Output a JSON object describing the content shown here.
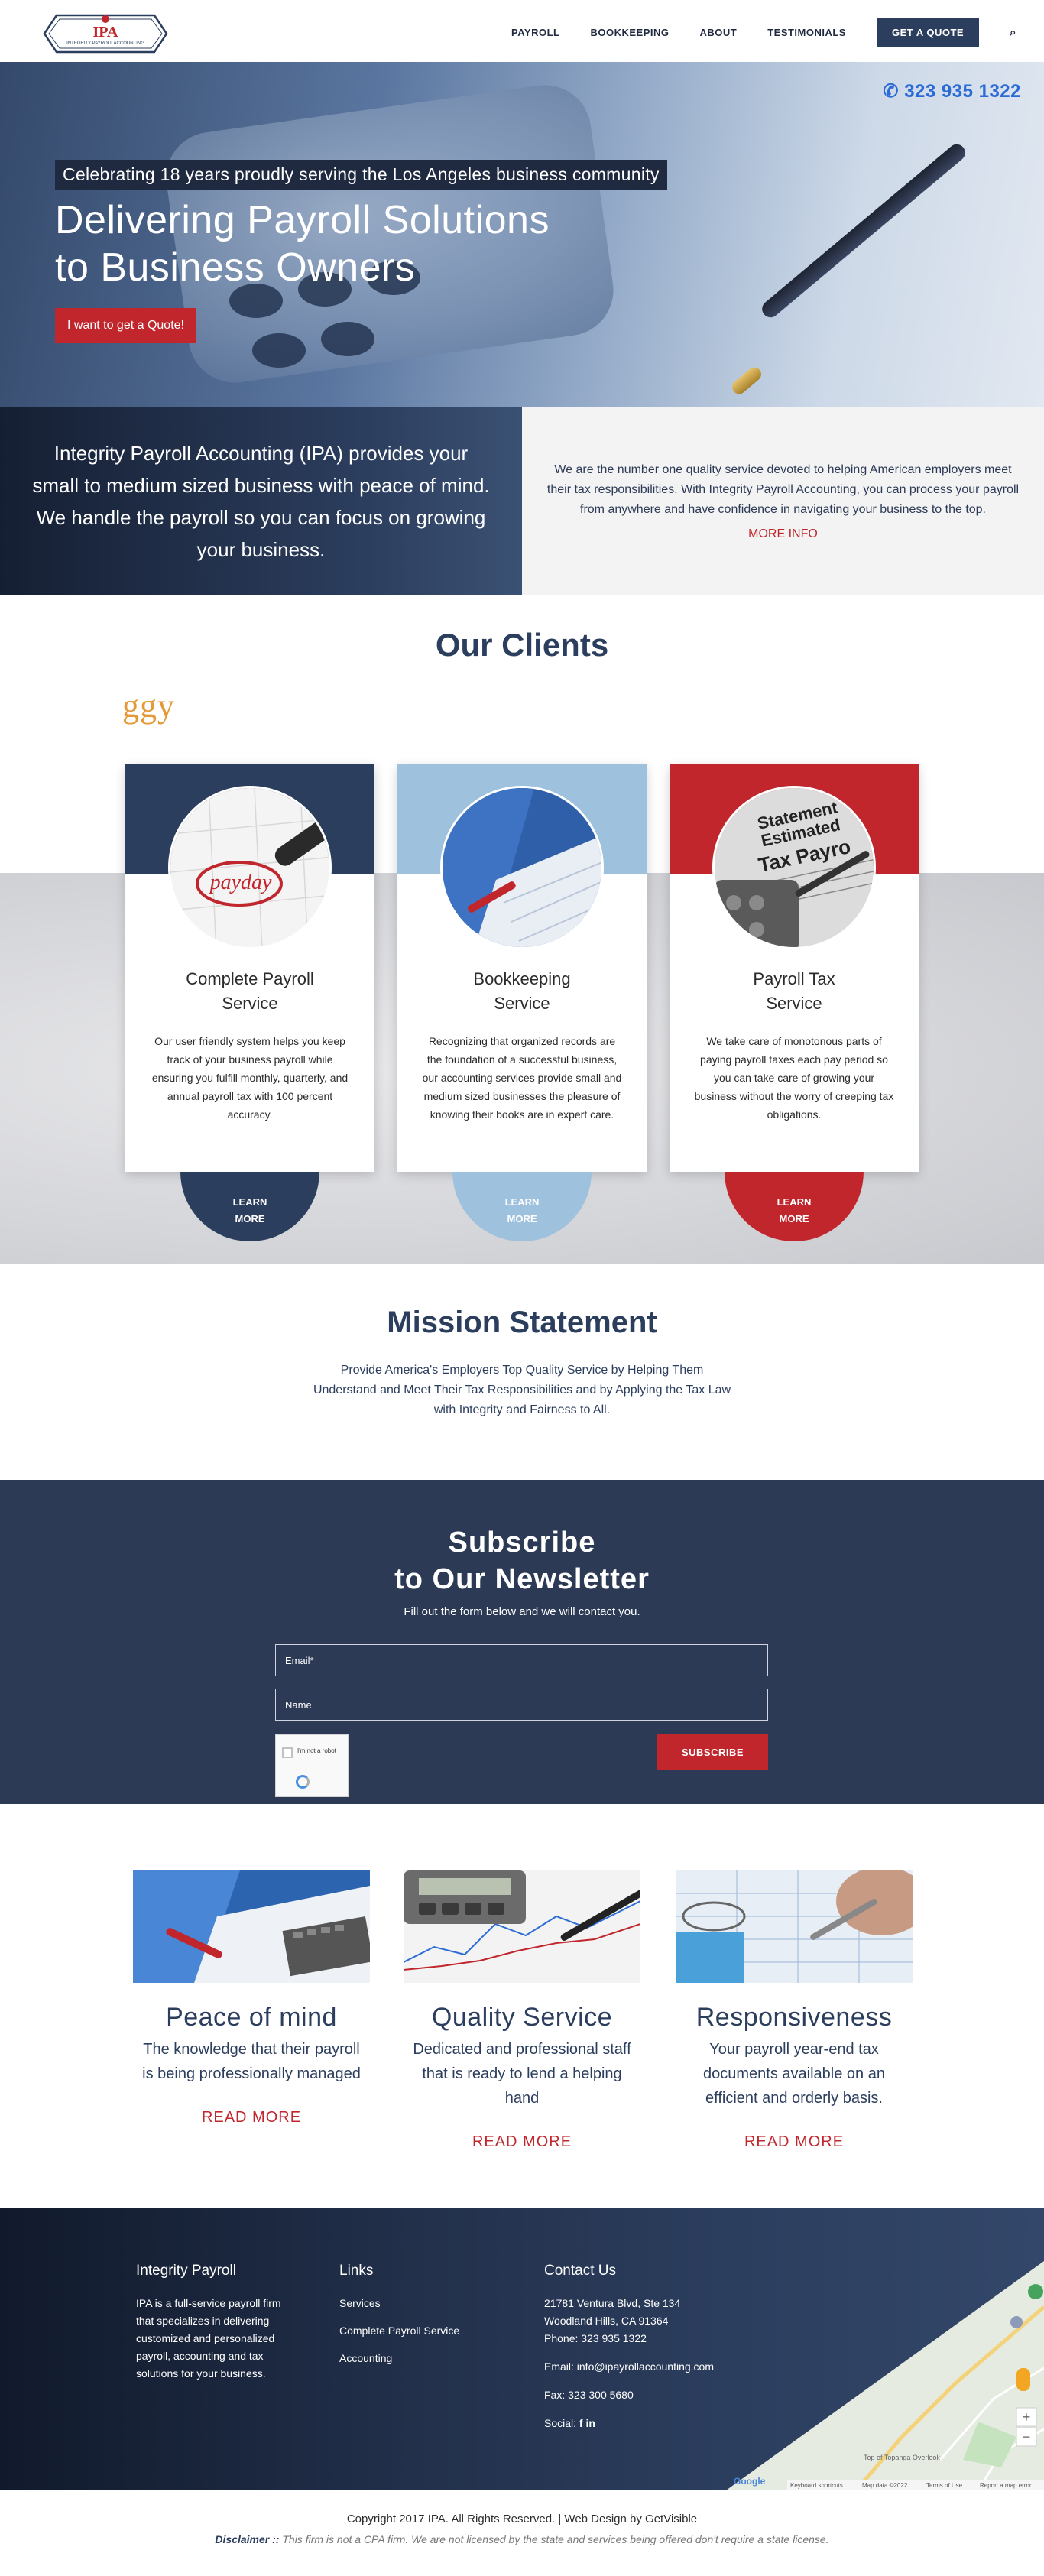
{
  "header": {
    "logo_text": "IPA",
    "logo_subtext": "INTEGRITY PAYROLL ACCOUNTING",
    "nav": [
      "PAYROLL",
      "BOOKKEEPING",
      "ABOUT",
      "TESTIMONIALS"
    ],
    "quote_button": "GET A QUOTE",
    "search_icon": "⌕"
  },
  "hero": {
    "phone": "323 935 1322",
    "phone_icon": "phone-icon",
    "tagline": "Celebrating 18 years proudly serving the Los Angeles business community",
    "headline_line1": "Delivering Payroll Solutions",
    "headline_line2": "to Business Owners",
    "cta": "I want to get a Quote!"
  },
  "intro": {
    "left_text": "Integrity Payroll Accounting (IPA) provides your small to medium sized business with peace of mind. We handle the payroll so you can focus on growing your business.",
    "right_text": "We are the number one quality service devoted to helping American employers meet their tax responsibilities. With Integrity Payroll Accounting, you can process your payroll from anywhere and have confidence in navigating your business to the top.",
    "more_info": "MORE INFO"
  },
  "clients": {
    "title": "Our Clients",
    "logo_fragment": "ggy"
  },
  "services": [
    {
      "title_line1": "Complete Payroll",
      "title_line2": "Service",
      "text": "Our user friendly system helps you keep track of your business payroll while ensuring you fulfill monthly, quarterly, and annual payroll tax with 100 percent accuracy.",
      "button_line1": "LEARN",
      "button_line2": "MORE",
      "band_color": "#2c3e5e",
      "button_color": "#2c3e5e"
    },
    {
      "title_line1": "Bookkeeping",
      "title_line2": "Service",
      "text": "Recognizing that organized records are the foundation of a successful business, our accounting services provide small and medium sized businesses the pleasure of knowing their books are in expert care.",
      "button_line1": "LEARN",
      "button_line2": "MORE",
      "band_color": "#9ec1de",
      "button_color": "#9ec1de"
    },
    {
      "title_line1": "Payroll Tax",
      "title_line2": "Service",
      "text": "We take care of monotonous parts of paying payroll taxes each pay period so you can take care of growing your business without the worry of creeping tax obligations.",
      "button_line1": "LEARN",
      "button_line2": "MORE",
      "band_color": "#c0262c",
      "button_color": "#c0262c"
    }
  ],
  "mission": {
    "title": "Mission Statement",
    "text": "Provide America's Employers Top Quality Service by Helping Them Understand and Meet Their Tax Responsibilities and by Applying the Tax Law with Integrity and Fairness to All."
  },
  "newsletter": {
    "title_line1": "Subscribe",
    "title_line2": "to Our Newsletter",
    "subtitle": "Fill out the form below and we will contact you.",
    "email_placeholder": "Email*",
    "name_placeholder": "Name",
    "captcha_label": "I'm not a robot",
    "subscribe": "SUBSCRIBE"
  },
  "features": [
    {
      "title": "Peace of mind",
      "text": "The knowledge that their payroll is being professionally managed",
      "link": "READ MORE"
    },
    {
      "title": "Quality Service",
      "text": "Dedicated and professional staff that is ready to lend a helping hand",
      "link": "READ MORE"
    },
    {
      "title": "Responsiveness",
      "text": "Your payroll year-end tax documents available on an efficient and orderly basis.",
      "link": "READ MORE"
    }
  ],
  "footer": {
    "col1_title": "Integrity Payroll",
    "col1_text": "IPA is a full-service payroll firm that specializes in delivering customized and personalized payroll, accounting and tax solutions for your business.",
    "col2_title": "Links",
    "links": [
      "Services",
      "Complete Payroll Service",
      "Accounting"
    ],
    "col3_title": "Contact Us",
    "address1": "21781 Ventura Blvd, Ste 134",
    "address2": "Woodland Hills, CA 91364",
    "phone": "Phone: 323 935 1322",
    "email": "Email: info@ipayrollaccounting.com",
    "fax": "Fax: 323 300 5680",
    "social_label": "Social:",
    "social_icons": [
      "facebook-icon",
      "linkedin-icon"
    ],
    "map_labels": [
      "Top of Topanga Overlook",
      "Keyboard shortcuts",
      "Map data ©2022",
      "Terms of Use",
      "Report a map error"
    ],
    "copyright": "Copyright 2017 IPA. All Rights Reserved. | Web Design by GetVisible",
    "disclaimer_label": "Disclaimer ::",
    "disclaimer_text": "This firm is not a CPA firm. We are not licensed by the state and services being offered don't require a state license."
  },
  "colors": {
    "navy": "#2c3e5e",
    "red": "#c0262c",
    "light_blue": "#9ec1de"
  }
}
